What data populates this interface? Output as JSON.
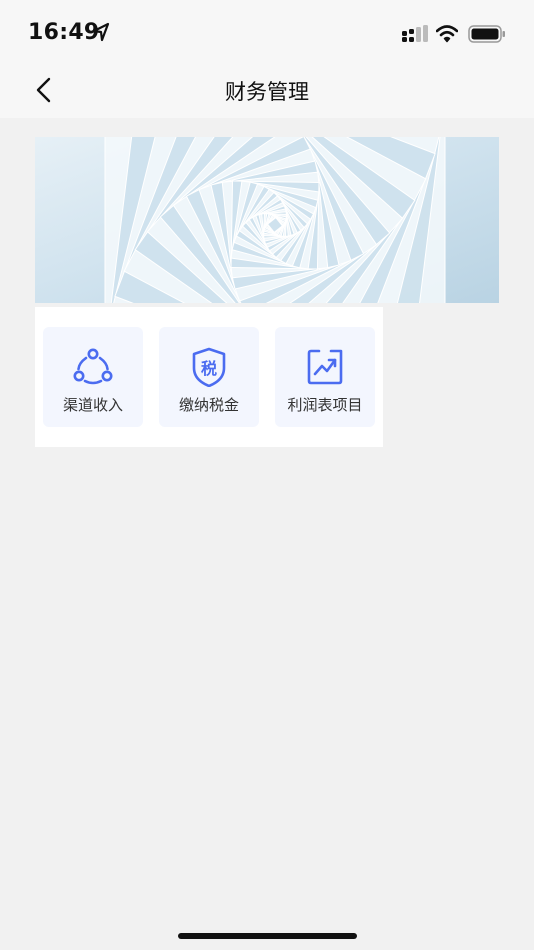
{
  "status_bar": {
    "time": "16:49",
    "location_icon": "location-arrow-icon",
    "signal_icon": "cellular-signal-icon",
    "wifi_icon": "wifi-icon",
    "battery_icon": "battery-icon"
  },
  "nav": {
    "title": "财务管理",
    "back_icon": "chevron-left-icon"
  },
  "banner": {
    "image": "spiral-geometric-banner"
  },
  "menu": {
    "items": [
      {
        "label": "渠道收入",
        "icon": "share-nodes-icon"
      },
      {
        "label": "缴纳税金",
        "icon": "tax-shield-icon",
        "icon_text": "税"
      },
      {
        "label": "利润表项目",
        "icon": "trend-chart-icon"
      }
    ]
  },
  "colors": {
    "accent": "#4b6cf0",
    "tile_background": "#f3f6fe",
    "page_background": "#f1f1f1"
  }
}
